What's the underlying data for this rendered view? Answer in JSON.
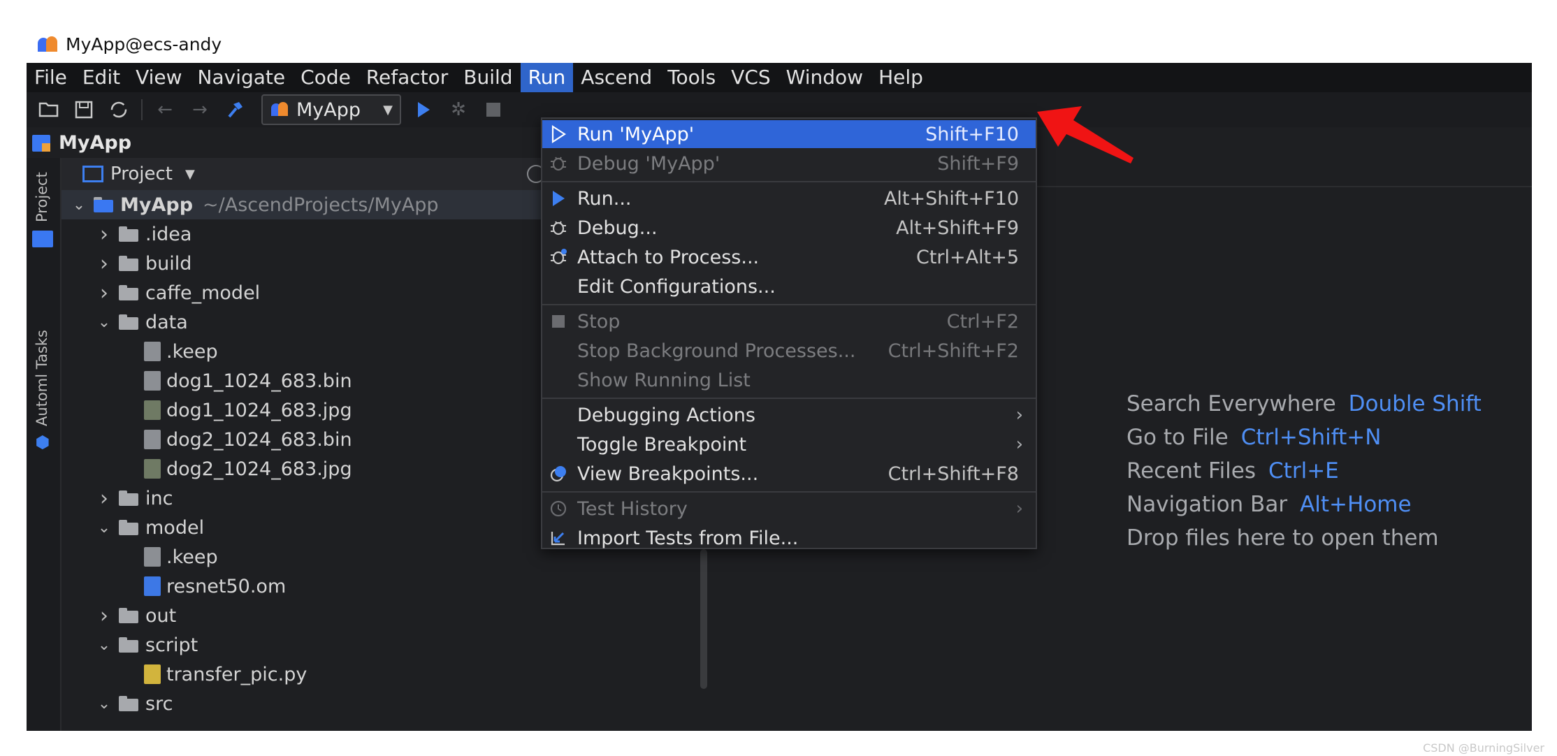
{
  "window": {
    "title": "MyApp@ecs-andy"
  },
  "menu": [
    "File",
    "Edit",
    "View",
    "Navigate",
    "Code",
    "Refactor",
    "Build",
    "Run",
    "Ascend",
    "Tools",
    "VCS",
    "Window",
    "Help"
  ],
  "active_menu": "Run",
  "toolbar": {
    "run_config": "MyApp"
  },
  "project_bar": {
    "name": "MyApp"
  },
  "side_tabs": {
    "project": "Project",
    "automl": "Automl Tasks"
  },
  "panel": {
    "header": "Project"
  },
  "tree": [
    {
      "label": "MyApp",
      "path": "~/AscendProjects/MyApp",
      "depth": 0,
      "kind": "module",
      "expanded": true
    },
    {
      "label": ".idea",
      "depth": 1,
      "kind": "folder",
      "expanded": false
    },
    {
      "label": "build",
      "depth": 1,
      "kind": "folder",
      "expanded": false
    },
    {
      "label": "caffe_model",
      "depth": 1,
      "kind": "folder",
      "expanded": false
    },
    {
      "label": "data",
      "depth": 1,
      "kind": "folder",
      "expanded": true
    },
    {
      "label": ".keep",
      "depth": 2,
      "kind": "file"
    },
    {
      "label": "dog1_1024_683.bin",
      "depth": 2,
      "kind": "file"
    },
    {
      "label": "dog1_1024_683.jpg",
      "depth": 2,
      "kind": "img"
    },
    {
      "label": "dog2_1024_683.bin",
      "depth": 2,
      "kind": "file"
    },
    {
      "label": "dog2_1024_683.jpg",
      "depth": 2,
      "kind": "img"
    },
    {
      "label": "inc",
      "depth": 1,
      "kind": "folder",
      "expanded": false
    },
    {
      "label": "model",
      "depth": 1,
      "kind": "folder",
      "expanded": true
    },
    {
      "label": ".keep",
      "depth": 2,
      "kind": "file"
    },
    {
      "label": "resnet50.om",
      "depth": 2,
      "kind": "om"
    },
    {
      "label": "out",
      "depth": 1,
      "kind": "folder",
      "expanded": false
    },
    {
      "label": "script",
      "depth": 1,
      "kind": "folder",
      "expanded": true
    },
    {
      "label": "transfer_pic.py",
      "depth": 2,
      "kind": "py"
    },
    {
      "label": "src",
      "depth": 1,
      "kind": "folder",
      "expanded": true
    }
  ],
  "run_menu": [
    {
      "label": "Run 'MyApp'",
      "shortcut": "Shift+F10",
      "icon": "run-outline-icon",
      "state": "highlighted"
    },
    {
      "label": "Debug 'MyApp'",
      "shortcut": "Shift+F9",
      "icon": "bug-icon",
      "state": "disabled"
    },
    {
      "sep": true
    },
    {
      "label": "Run...",
      "shortcut": "Alt+Shift+F10",
      "icon": "run-icon",
      "state": "normal"
    },
    {
      "label": "Debug...",
      "shortcut": "Alt+Shift+F9",
      "icon": "bug-icon",
      "state": "normal"
    },
    {
      "label": "Attach to Process...",
      "shortcut": "Ctrl+Alt+5",
      "icon": "attach-bug-icon",
      "state": "normal"
    },
    {
      "label": "Edit Configurations...",
      "shortcut": "",
      "icon": "",
      "state": "normal"
    },
    {
      "sep": true
    },
    {
      "label": "Stop",
      "shortcut": "Ctrl+F2",
      "icon": "stop-icon",
      "state": "disabled"
    },
    {
      "label": "Stop Background Processes...",
      "shortcut": "Ctrl+Shift+F2",
      "icon": "",
      "state": "disabled"
    },
    {
      "label": "Show Running List",
      "shortcut": "",
      "icon": "",
      "state": "disabled"
    },
    {
      "sep": true
    },
    {
      "label": "Debugging Actions",
      "shortcut": "",
      "icon": "",
      "state": "normal",
      "submenu": true
    },
    {
      "label": "Toggle Breakpoint",
      "shortcut": "",
      "icon": "",
      "state": "normal",
      "submenu": true
    },
    {
      "label": "View Breakpoints...",
      "shortcut": "Ctrl+Shift+F8",
      "icon": "breakpoints-icon",
      "state": "normal"
    },
    {
      "sep": true
    },
    {
      "label": "Test History",
      "shortcut": "",
      "icon": "clock-icon",
      "state": "disabled",
      "submenu": true
    },
    {
      "label": "Import Tests from File...",
      "shortcut": "",
      "icon": "import-icon",
      "state": "normal"
    }
  ],
  "editor_hints": [
    {
      "label": "Search Everywhere",
      "key": "Double Shift"
    },
    {
      "label": "Go to File",
      "key": "Ctrl+Shift+N"
    },
    {
      "label": "Recent Files",
      "key": "Ctrl+E"
    },
    {
      "label": "Navigation Bar",
      "key": "Alt+Home"
    },
    {
      "label": "Drop files here to open them",
      "key": ""
    }
  ],
  "watermark": "CSDN @BurningSilver",
  "colors": {
    "accent": "#2f65d8",
    "annotation_arrow": "#f01414",
    "key_blue": "#4f8ff5"
  }
}
